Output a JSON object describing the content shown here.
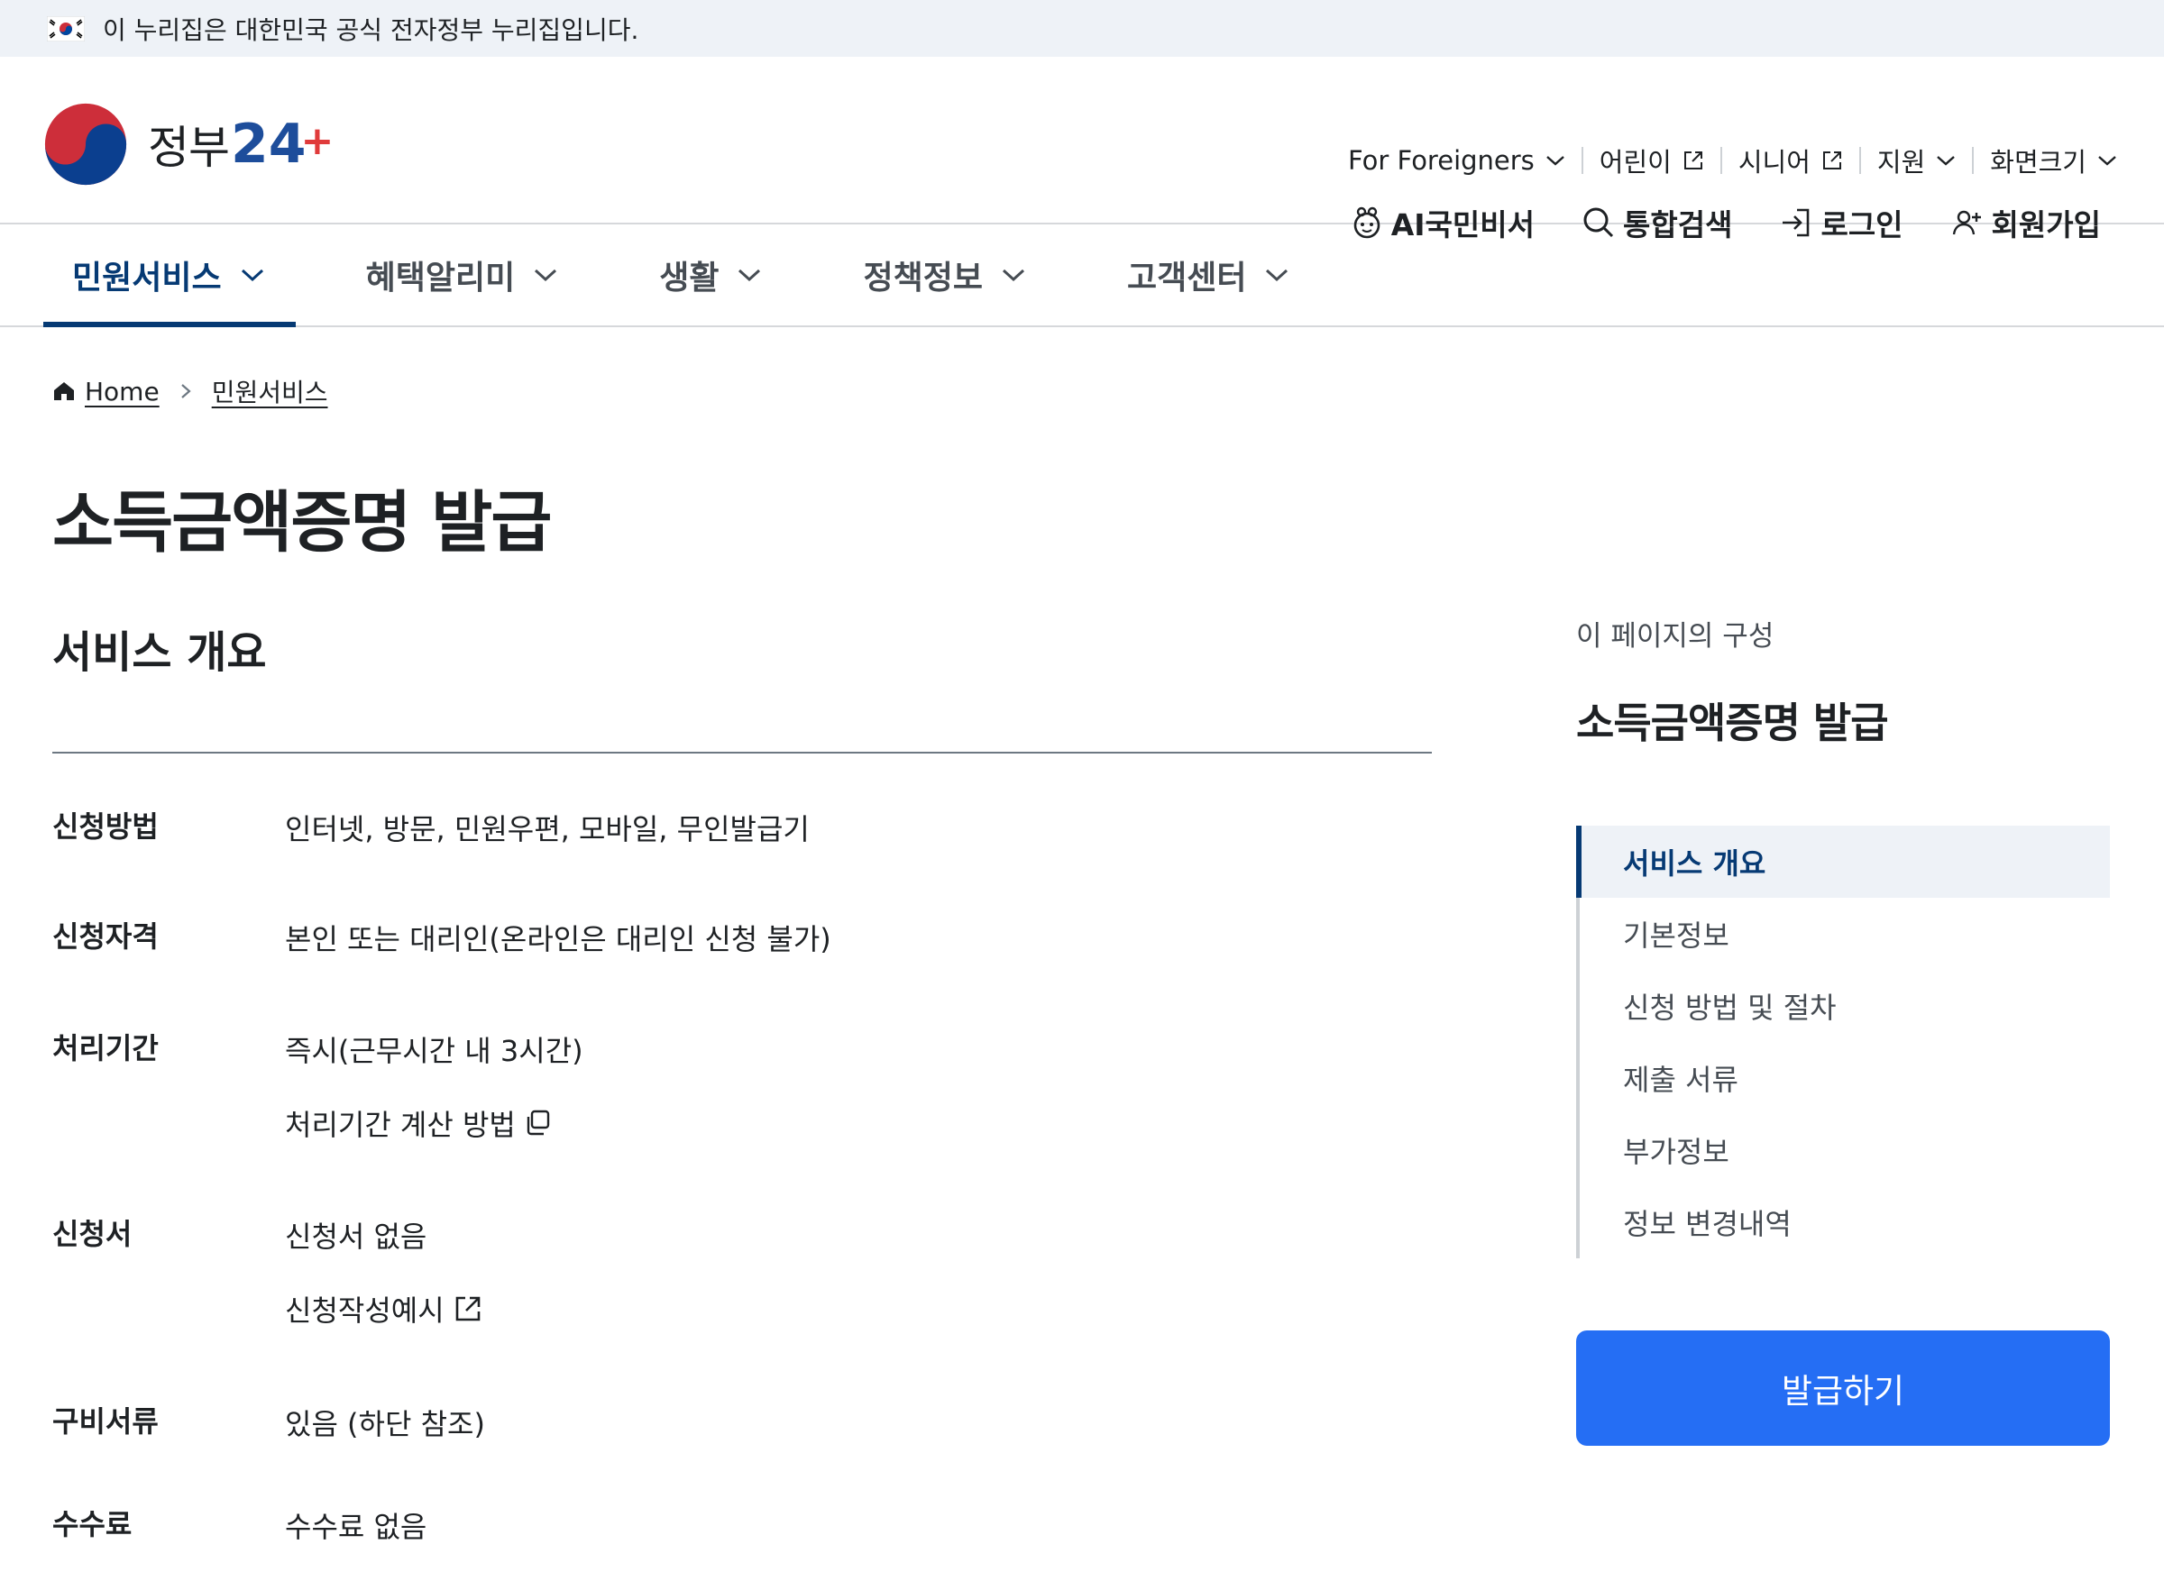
{
  "gov_banner": {
    "flag_icon": "korea-flag-icon",
    "text": "이 누리집은 대한민국 공식 전자정부 누리집입니다."
  },
  "logo": {
    "text": "정부",
    "num": "24",
    "plus": "+"
  },
  "util_top": [
    {
      "label": "For Foreigners",
      "icon": "chevron-down-icon"
    },
    {
      "label": "어린이",
      "icon": "external-link-icon"
    },
    {
      "label": "시니어",
      "icon": "external-link-icon"
    },
    {
      "label": "지원",
      "icon": "chevron-down-icon"
    },
    {
      "label": "화면크기",
      "icon": "chevron-down-icon"
    }
  ],
  "util_main": [
    {
      "label": "AI국민비서",
      "icon": "ai-assistant-icon"
    },
    {
      "label": "통합검색",
      "icon": "search-icon"
    },
    {
      "label": "로그인",
      "icon": "login-icon"
    },
    {
      "label": "회원가입",
      "icon": "signup-icon"
    }
  ],
  "gnb": [
    {
      "label": "민원서비스",
      "active": true
    },
    {
      "label": "혜택알리미",
      "active": false
    },
    {
      "label": "생활",
      "active": false
    },
    {
      "label": "정책정보",
      "active": false
    },
    {
      "label": "고객센터",
      "active": false
    }
  ],
  "breadcrumb": {
    "home": "Home",
    "current": "민원서비스"
  },
  "page_title": "소득금액증명 발급",
  "section_title": "서비스 개요",
  "info_rows": [
    {
      "label": "신청방법",
      "lines": [
        "인터넷, 방문, 민원우편, 모바일, 무인발급기"
      ]
    },
    {
      "label": "신청자격",
      "lines": [
        "본인 또는 대리인(온라인은 대리인 신청 불가)"
      ]
    },
    {
      "label": "처리기간",
      "lines": [
        "즉시(근무시간 내 3시간)",
        "처리기간 계산 방법"
      ]
    },
    {
      "label": "신청서",
      "lines": [
        "신청서 없음",
        "신청작성예시"
      ]
    },
    {
      "label": "구비서류",
      "lines": [
        "있음 (하단 참조)"
      ]
    },
    {
      "label": "수수료",
      "lines": [
        "수수료 없음"
      ]
    }
  ],
  "toc": {
    "caption": "이 페이지의 구성",
    "title": "소득금액증명 발급",
    "items": [
      "서비스 개요",
      "기본정보",
      "신청 방법 및 절차",
      "제출 서류",
      "부가정보",
      "정보 변경내역"
    ]
  },
  "issue_button": "발급하기",
  "colors": {
    "primary": "#256ef4",
    "navy": "#063a74",
    "banner_bg": "#eef2f7"
  }
}
